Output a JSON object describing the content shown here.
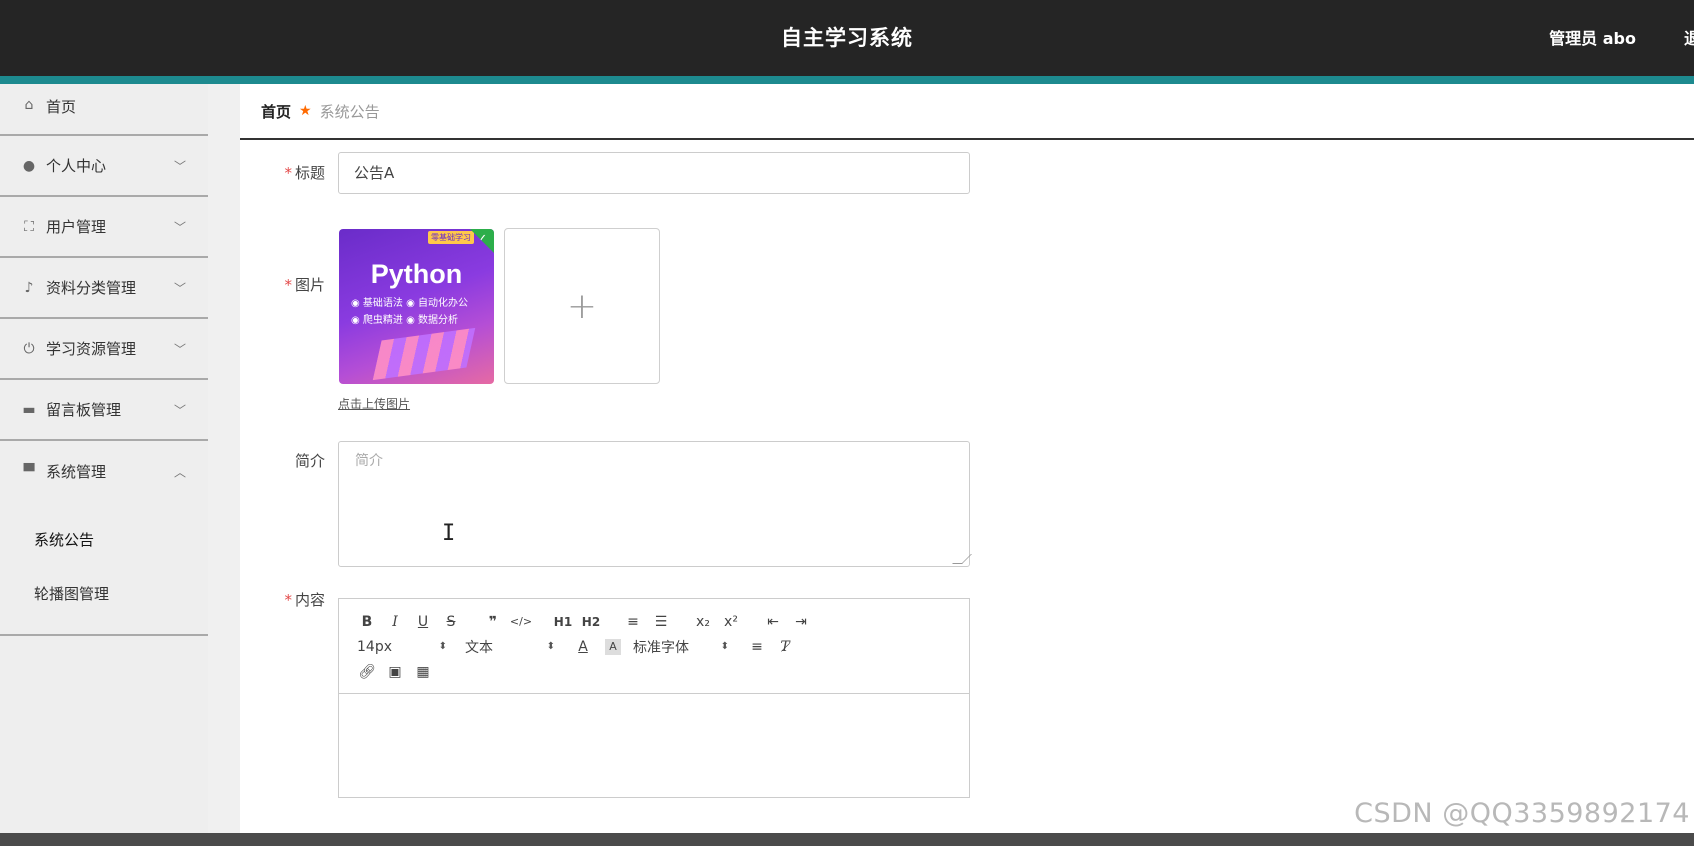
{
  "header": {
    "title": "自主学习系统",
    "user": "管理员 abo",
    "more": "退"
  },
  "sidebar": {
    "items": [
      {
        "label": "首页",
        "icon": "home-icon"
      },
      {
        "label": "个人中心",
        "icon": "user-icon",
        "arrow": "﹀"
      },
      {
        "label": "用户管理",
        "icon": "fullscreen-icon",
        "arrow": "﹀"
      },
      {
        "label": "资料分类管理",
        "icon": "microphone-icon",
        "arrow": "﹀"
      },
      {
        "label": "学习资源管理",
        "icon": "power-icon",
        "arrow": "﹀"
      },
      {
        "label": "留言板管理",
        "icon": "briefcase-icon",
        "arrow": "﹀"
      },
      {
        "label": "系统管理",
        "icon": "monitor-icon",
        "arrow": "︿"
      }
    ],
    "submenu": [
      {
        "label": "系统公告"
      },
      {
        "label": "轮播图管理"
      }
    ]
  },
  "breadcrumb": {
    "home": "首页",
    "current": "系统公告"
  },
  "form": {
    "title_label": "标题",
    "title_value": "公告A",
    "image_label": "图片",
    "image_thumb_text": "Python",
    "image_thumb_top": "零基础学习",
    "image_thumb_tags": [
      "基础语法",
      "自动化办公",
      "爬虫精进",
      "数据分析"
    ],
    "upload_plus": "+",
    "upload_hint": "点击上传图片",
    "intro_label": "简介",
    "intro_placeholder": "简介",
    "content_label": "内容"
  },
  "editor": {
    "toolbar_row1": [
      "B",
      "I",
      "U",
      "S",
      "❞",
      "</>",
      "H1",
      "H2",
      "≡",
      "☰",
      "x₂",
      "x²",
      "⇤",
      "⇥"
    ],
    "font_size": "14px",
    "block_type": "文本",
    "font_family": "标准字体",
    "caret": "⬍"
  },
  "watermark": "CSDN @QQ3359892174"
}
